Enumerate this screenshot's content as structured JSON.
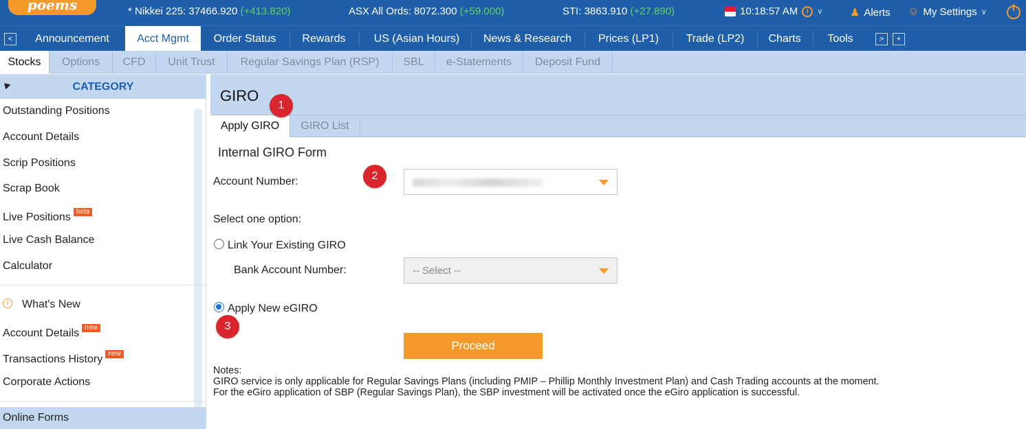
{
  "header": {
    "logo": "poems",
    "tickers": [
      {
        "name": "* Nikkei 225: 37466.920",
        "change": "(+413.820)"
      },
      {
        "name": "ASX All Ords: 8072.300",
        "change": "(+59.000)"
      },
      {
        "name": "STI: 3863.910",
        "change": "(+27.890)"
      }
    ],
    "time": "10:18:57 AM",
    "alerts": "Alerts",
    "settings": "My Settings"
  },
  "nav": {
    "prev": "<",
    "tabs": [
      "Announcement",
      "Acct Mgmt",
      "Order Status",
      "Rewards",
      "US (Asian Hours)",
      "News & Research",
      "Prices (LP1)",
      "Trade (LP2)",
      "Charts",
      "Tools"
    ],
    "next": ">",
    "add": "+"
  },
  "subnav": {
    "tabs": [
      "Stocks",
      "Options",
      "CFD",
      "Unit Trust",
      "Regular Savings Plan (RSP)",
      "SBL",
      "e-Statements",
      "Deposit Fund"
    ]
  },
  "sidebar": {
    "category": "CATEGORY",
    "items": [
      "Outstanding Positions",
      "Account Details",
      "Scrip Positions",
      "Scrap Book",
      "Live Positions",
      "Live Cash Balance",
      "Calculator"
    ],
    "beta_badge": "beta",
    "whats_new": "What's New",
    "new_items": [
      "Account Details",
      "Transactions History"
    ],
    "new_badge": "new",
    "corporate_actions": "Corporate Actions",
    "online_forms": "Online Forms"
  },
  "content": {
    "title": "GIRO",
    "tabs": [
      "Apply GIRO",
      "GIRO List"
    ],
    "form_title": "Internal GIRO Form",
    "account_number_label": "Account Number:",
    "select_option_label": "Select one option:",
    "link_existing": "Link Your Existing GIRO",
    "bank_account_label": "Bank Account Number:",
    "bank_select_placeholder": "-- Select --",
    "apply_new": "Apply New eGIRO",
    "proceed": "Proceed",
    "notes_title": "Notes:",
    "notes": [
      "GIRO service is only applicable for Regular Savings Plans (including PMIP – Phillip Monthly Investment Plan) and Cash Trading accounts at the moment.",
      "For the eGiro application of SBP (Regular Savings Plan), the SBP investment will be activated once the eGiro application is successful."
    ]
  },
  "markers": [
    "1",
    "2",
    "3"
  ],
  "colors": {
    "brand_blue": "#1f5faa",
    "accent_orange": "#f39a2b",
    "light_blue": "#c3d8f0",
    "marker_red": "#d9262e",
    "up_green": "#5fd35f"
  }
}
